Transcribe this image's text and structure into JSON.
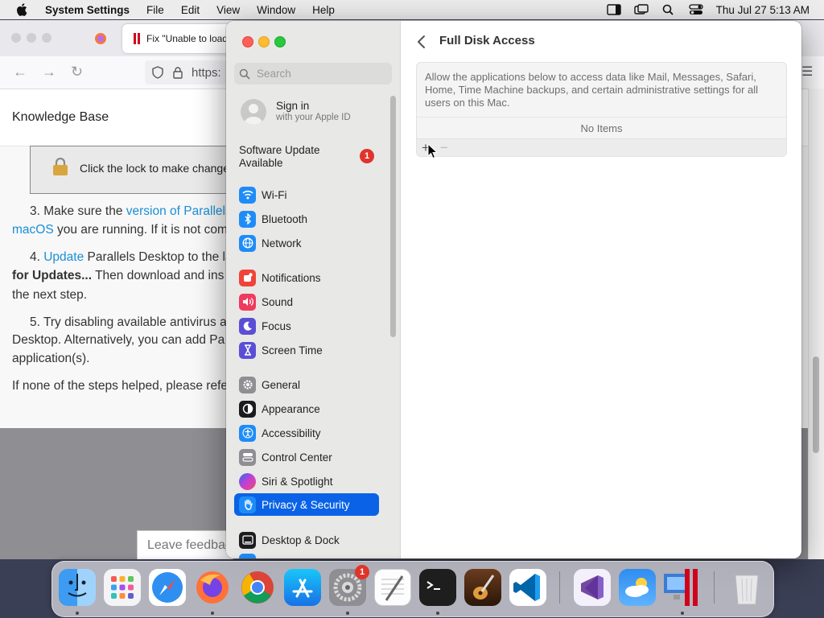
{
  "menubar": {
    "app": "System Settings",
    "items": [
      "File",
      "Edit",
      "View",
      "Window",
      "Help"
    ],
    "clock": "Thu Jul 27  5:13 AM"
  },
  "browser": {
    "tab_title": "Fix \"Unable to load",
    "url": "https:",
    "kb_title": "Knowledge Base",
    "lock_text": "Click the lock to make changes",
    "step3_prefix": "3. Make sure the ",
    "step3_link": "version of Parallels",
    "step3_link2": "macOS",
    "step3_rest": " you are running. If it is not com",
    "step4_link": "Update",
    "step4_rest": " Parallels Desktop to the la",
    "step4_bold": "for Updates...",
    "step4_cont": " Then download and ins",
    "step4_end": "the next step.",
    "step5_a": "5. Try disabling available antivirus ap",
    "step5_b": "Desktop. Alternatively, you can add Pa",
    "step5_c": "application(s).",
    "final": "If none of the steps helped, please refe",
    "feedback": "Leave feedbac"
  },
  "sidebar": {
    "search_placeholder": "Search",
    "signin_title": "Sign in",
    "signin_sub": "with your Apple ID",
    "update_label": "Software Update Available",
    "update_badge": "1",
    "items": [
      {
        "label": "Wi-Fi",
        "icon": "wifi-icon",
        "color": "#1e8cf7"
      },
      {
        "label": "Bluetooth",
        "icon": "bluetooth-icon",
        "color": "#1e8cf7"
      },
      {
        "label": "Network",
        "icon": "globe-icon",
        "color": "#1e8cf7"
      },
      {
        "label": "Notifications",
        "icon": "bell-icon",
        "color": "#f0443a"
      },
      {
        "label": "Sound",
        "icon": "speaker-icon",
        "color": "#f03a5f"
      },
      {
        "label": "Focus",
        "icon": "moon-icon",
        "color": "#5a4fd4"
      },
      {
        "label": "Screen Time",
        "icon": "hourglass-icon",
        "color": "#5a4fd4"
      },
      {
        "label": "General",
        "icon": "gear-icon",
        "color": "#8e8e93"
      },
      {
        "label": "Appearance",
        "icon": "appearance-icon",
        "color": "#1c1c1e"
      },
      {
        "label": "Accessibility",
        "icon": "accessibility-icon",
        "color": "#1e8cf7"
      },
      {
        "label": "Control Center",
        "icon": "control-center-icon",
        "color": "#8e8e93"
      },
      {
        "label": "Siri & Spotlight",
        "icon": "siri-icon",
        "color": "#a44fd9"
      },
      {
        "label": "Privacy & Security",
        "icon": "hand-icon",
        "color": "#1e8cf7",
        "selected": true
      },
      {
        "label": "Desktop & Dock",
        "icon": "dock-icon",
        "color": "#1c1c1e"
      }
    ]
  },
  "pane": {
    "title": "Full Disk Access",
    "description": "Allow the applications below to access data like Mail, Messages, Safari, Home, Time Machine backups, and certain administrative settings for all users on this Mac.",
    "empty_text": "No Items",
    "add_label": "+",
    "remove_label": "−"
  },
  "dock": {
    "settings_badge": "1",
    "apps": [
      "finder",
      "launchpad",
      "safari",
      "firefox",
      "chrome",
      "app-store",
      "system-settings",
      "textedit",
      "terminal",
      "garageband",
      "vscode",
      "visual-studio",
      "weather",
      "parallels-desktop",
      "trash"
    ]
  }
}
